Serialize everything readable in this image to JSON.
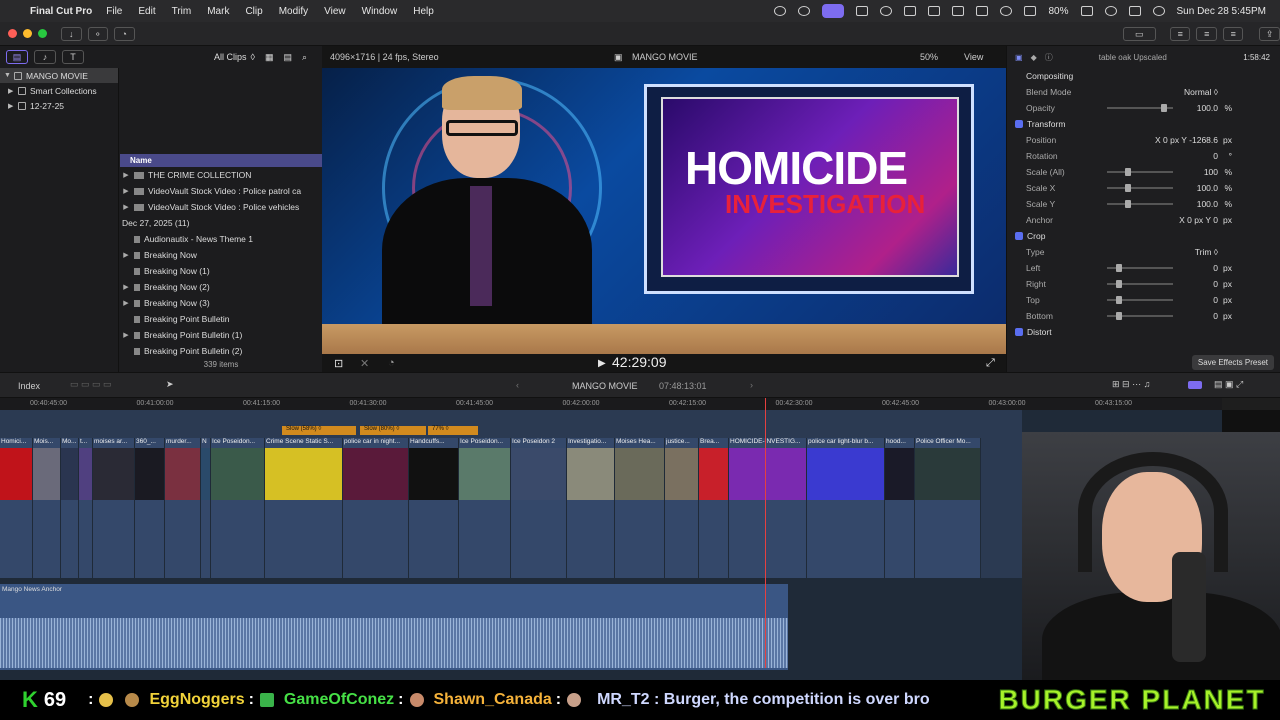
{
  "menubar": {
    "app_name": "Final Cut Pro",
    "items": [
      "File",
      "Edit",
      "Trim",
      "Mark",
      "Clip",
      "Modify",
      "View",
      "Window",
      "Help"
    ],
    "battery": "80%",
    "datetime": "Sun Dec 28  5:45PM"
  },
  "browser": {
    "filter": "All Clips",
    "library": [
      {
        "label": "MANGO MOVIE",
        "selected": true
      },
      {
        "label": "Smart Collections"
      },
      {
        "label": "12-27-25"
      }
    ],
    "column_header": "Name",
    "rows": [
      {
        "label": "THE CRIME COLLECTION",
        "tri": "▶"
      },
      {
        "label": "VideoVault Stock Video : Police patrol ca",
        "tri": "▶"
      },
      {
        "label": "VideoVault Stock Video : Police vehicles",
        "tri": "▶"
      },
      {
        "label": "Dec 27, 2025  (11)",
        "tri": "▼"
      },
      {
        "label": "Audionautix - News Theme 1",
        "tri": ""
      },
      {
        "label": "Breaking Now",
        "tri": "▶"
      },
      {
        "label": "Breaking Now (1)",
        "tri": ""
      },
      {
        "label": "Breaking Now (2)",
        "tri": "▶"
      },
      {
        "label": "Breaking Now (3)",
        "tri": "▶"
      },
      {
        "label": "Breaking Point Bulletin",
        "tri": ""
      },
      {
        "label": "Breaking Point Bulletin (1)",
        "tri": "▶"
      },
      {
        "label": "Breaking Point Bulletin (2)",
        "tri": ""
      }
    ],
    "item_count": "339 items"
  },
  "viewer": {
    "format": "4096×1716 | 24 fps, Stereo",
    "project": "MANGO MOVIE",
    "zoom": "50%",
    "view_menu": "View",
    "timecode": "42:29:09",
    "graphic_line1": "HOMICIDE",
    "graphic_line2": "INVESTIGATION"
  },
  "inspector": {
    "clip_name": "table oak Upscaled",
    "duration": "1:58:42",
    "rows": [
      {
        "type": "section",
        "label": "Compositing"
      },
      {
        "type": "row",
        "label": "Blend Mode",
        "value": "Normal ◊"
      },
      {
        "type": "row",
        "label": "Opacity",
        "value": "100.0",
        "unit": "%",
        "slider": 0.9
      },
      {
        "type": "section",
        "label": "Transform",
        "checked": true
      },
      {
        "type": "row",
        "label": "Position",
        "value": "X   0 px   Y  -1268.6",
        "unit": "px"
      },
      {
        "type": "row",
        "label": "Rotation",
        "value": "0",
        "unit": "°"
      },
      {
        "type": "row",
        "label": "Scale (All)",
        "value": "100",
        "unit": "%",
        "slider": 0.3
      },
      {
        "type": "row",
        "label": "Scale X",
        "value": "100.0",
        "unit": "%",
        "slider": 0.3
      },
      {
        "type": "row",
        "label": "Scale Y",
        "value": "100.0",
        "unit": "%",
        "slider": 0.3
      },
      {
        "type": "row",
        "label": "Anchor",
        "value": "X   0 px   Y   0",
        "unit": "px"
      },
      {
        "type": "section",
        "label": "Crop",
        "checked": true
      },
      {
        "type": "row",
        "label": "Type",
        "value": "Trim ◊"
      },
      {
        "type": "row",
        "label": "Left",
        "value": "0",
        "unit": "px",
        "slider": 0.15
      },
      {
        "type": "row",
        "label": "Right",
        "value": "0",
        "unit": "px",
        "slider": 0.15
      },
      {
        "type": "row",
        "label": "Top",
        "value": "0",
        "unit": "px",
        "slider": 0.15
      },
      {
        "type": "row",
        "label": "Bottom",
        "value": "0",
        "unit": "px",
        "slider": 0.15
      },
      {
        "type": "section",
        "label": "Distort",
        "checked": true
      }
    ],
    "save_preset": "Save Effects Preset"
  },
  "timeline": {
    "index_label": "Index",
    "project": "MANGO MOVIE",
    "duration": "07:48:13:01",
    "ruler": [
      "00:40:45:00",
      "00:41:00:00",
      "00:41:15:00",
      "00:41:30:00",
      "00:41:45:00",
      "00:42:00:00",
      "00:42:15:00",
      "00:42:30:00",
      "00:42:45:00",
      "00:43:00:00",
      "00:43:15:00"
    ],
    "retime": [
      "Slow (58%) ◊",
      "Slow (80%) ◊",
      "77% ◊"
    ],
    "clips": [
      {
        "name": "Homici...",
        "color": "#c0131a"
      },
      {
        "name": "Mois...",
        "color": "#6a6a7a"
      },
      {
        "name": "Mo...",
        "color": "#2a3550"
      },
      {
        "name": "t...",
        "color": "#504080"
      },
      {
        "name": "moises ar...",
        "color": "#2a2a35"
      },
      {
        "name": "360_...",
        "color": "#1a1a22"
      },
      {
        "name": "murder...",
        "color": "#7a3040"
      },
      {
        "name": "N",
        "color": "#2a4a6a"
      },
      {
        "name": "Ice Poseidon...",
        "color": "#3a5a4a"
      },
      {
        "name": "Crime Scene Static S...",
        "color": "#d6c024"
      },
      {
        "name": "police  car in night...",
        "color": "#5a1a3a"
      },
      {
        "name": "Handcuffs...",
        "color": "#111111"
      },
      {
        "name": "Ice Poseidon...",
        "color": "#5a7a6a"
      },
      {
        "name": "Ice Poseidon 2",
        "color": "#3a4a6a"
      },
      {
        "name": "Investigatio...",
        "color": "#8a8a7a"
      },
      {
        "name": "Moises Hea...",
        "color": "#6a6a5a"
      },
      {
        "name": "justice...",
        "color": "#7a7060"
      },
      {
        "name": "Brea...",
        "color": "#c8202a"
      },
      {
        "name": "HOMICIDE-INVESTIG...",
        "color": "#7a2ab0"
      },
      {
        "name": "police car light-blur b...",
        "color": "#3a3ad0"
      },
      {
        "name": "hood...",
        "color": "#1a1a28"
      },
      {
        "name": "Police Officer Mo...",
        "color": "#2a3a3a"
      }
    ],
    "audio_label": "Mango News Anchor"
  },
  "ticker": {
    "count_k": "K",
    "count_n": "69",
    "user1": "EggNoggers",
    "user2": "GameOfConez",
    "user3": "Shawn_Canada",
    "msg": "MR_T2 : Burger, the competition is over bro",
    "brand": "BURGER PLANET"
  }
}
